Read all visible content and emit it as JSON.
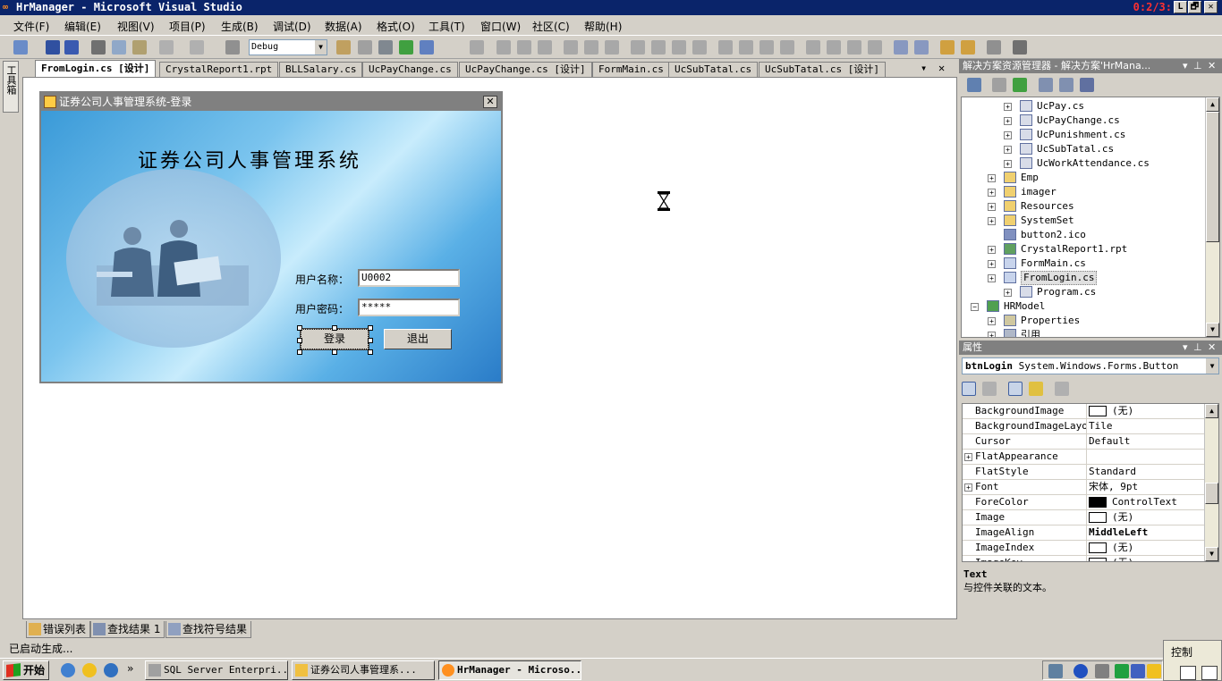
{
  "window": {
    "title": "HrManager - Microsoft Visual Studio",
    "timer": "0:2/3:",
    "controls": [
      "L",
      "🗗",
      "✕"
    ]
  },
  "menu": [
    "文件(F)",
    "编辑(E)",
    "视图(V)",
    "项目(P)",
    "生成(B)",
    "调试(D)",
    "数据(A)",
    "格式(O)",
    "工具(T)",
    "窗口(W)",
    "社区(C)",
    "帮助(H)"
  ],
  "toolbar": {
    "config": "Debug"
  },
  "toolbox": {
    "label": "工具箱"
  },
  "doc_tabs": [
    {
      "label": "FromLogin.cs [设计]",
      "active": true
    },
    {
      "label": "CrystalReport1.rpt"
    },
    {
      "label": "BLLSalary.cs"
    },
    {
      "label": "UcPayChange.cs"
    },
    {
      "label": "UcPayChange.cs [设计]"
    },
    {
      "label": "FormMain.cs"
    },
    {
      "label": "UcSubTatal.cs"
    },
    {
      "label": "UcSubTatal.cs [设计]"
    }
  ],
  "login_form": {
    "title": "证券公司人事管理系统-登录",
    "heading": "证券公司人事管理系统",
    "username_label": "用户名称：",
    "username_value": "U0002",
    "password_label": "用户密码：",
    "password_value": "*****",
    "login_button": "登录",
    "exit_button": "退出"
  },
  "bottom_tabs": [
    "错误列表",
    "查找结果 1",
    "查找符号结果"
  ],
  "status": "已启动生成...",
  "solution_explorer": {
    "title": "解决方案资源管理器 - 解决方案'HrMana...",
    "items": [
      {
        "label": "UcPay.cs",
        "type": "cs"
      },
      {
        "label": "UcPayChange.cs",
        "type": "cs"
      },
      {
        "label": "UcPunishment.cs",
        "type": "cs"
      },
      {
        "label": "UcSubTatal.cs",
        "type": "cs"
      },
      {
        "label": "UcWorkAttendance.cs",
        "type": "cs"
      },
      {
        "label": "Emp",
        "type": "folder"
      },
      {
        "label": "imager",
        "type": "folder"
      },
      {
        "label": "Resources",
        "type": "folder"
      },
      {
        "label": "SystemSet",
        "type": "folder"
      },
      {
        "label": "button2.ico",
        "type": "ico"
      },
      {
        "label": "CrystalReport1.rpt",
        "type": "rpt"
      },
      {
        "label": "FormMain.cs",
        "type": "form"
      },
      {
        "label": "FromLogin.cs",
        "type": "form",
        "selected": true
      },
      {
        "label": "Program.cs",
        "type": "cs"
      },
      {
        "label": "HRModel",
        "type": "project"
      },
      {
        "label": "Properties",
        "type": "props"
      },
      {
        "label": "引用",
        "type": "refs"
      }
    ]
  },
  "properties": {
    "title": "属性",
    "object_name": "btnLogin",
    "object_type": "System.Windows.Forms.Button",
    "rows": [
      {
        "name": "BackgroundImage",
        "value": "(无)",
        "swatch": "#ffffff"
      },
      {
        "name": "BackgroundImageLayou",
        "value": "Tile"
      },
      {
        "name": "Cursor",
        "value": "Default"
      },
      {
        "name": "FlatAppearance",
        "value": "",
        "expandable": true
      },
      {
        "name": "FlatStyle",
        "value": "Standard"
      },
      {
        "name": "Font",
        "value": "宋体, 9pt",
        "expandable": true
      },
      {
        "name": "ForeColor",
        "value": "ControlText",
        "swatch": "#000000"
      },
      {
        "name": "Image",
        "value": "(无)",
        "swatch": "#ffffff"
      },
      {
        "name": "ImageAlign",
        "value": "MiddleLeft",
        "bold": true
      },
      {
        "name": "ImageIndex",
        "value": "(无)",
        "swatch": "#ffffff"
      },
      {
        "name": "ImageKey",
        "value": "(无)",
        "swatch": "#ffffff"
      }
    ],
    "desc_title": "Text",
    "desc_text": "与控件关联的文本。"
  },
  "taskbar": {
    "start": "开始",
    "tasks": [
      {
        "label": "SQL Server Enterpri..."
      },
      {
        "label": "证券公司人事管理系..."
      },
      {
        "label": "HrManager - Microso...",
        "active": true
      }
    ],
    "popup": "控制"
  }
}
